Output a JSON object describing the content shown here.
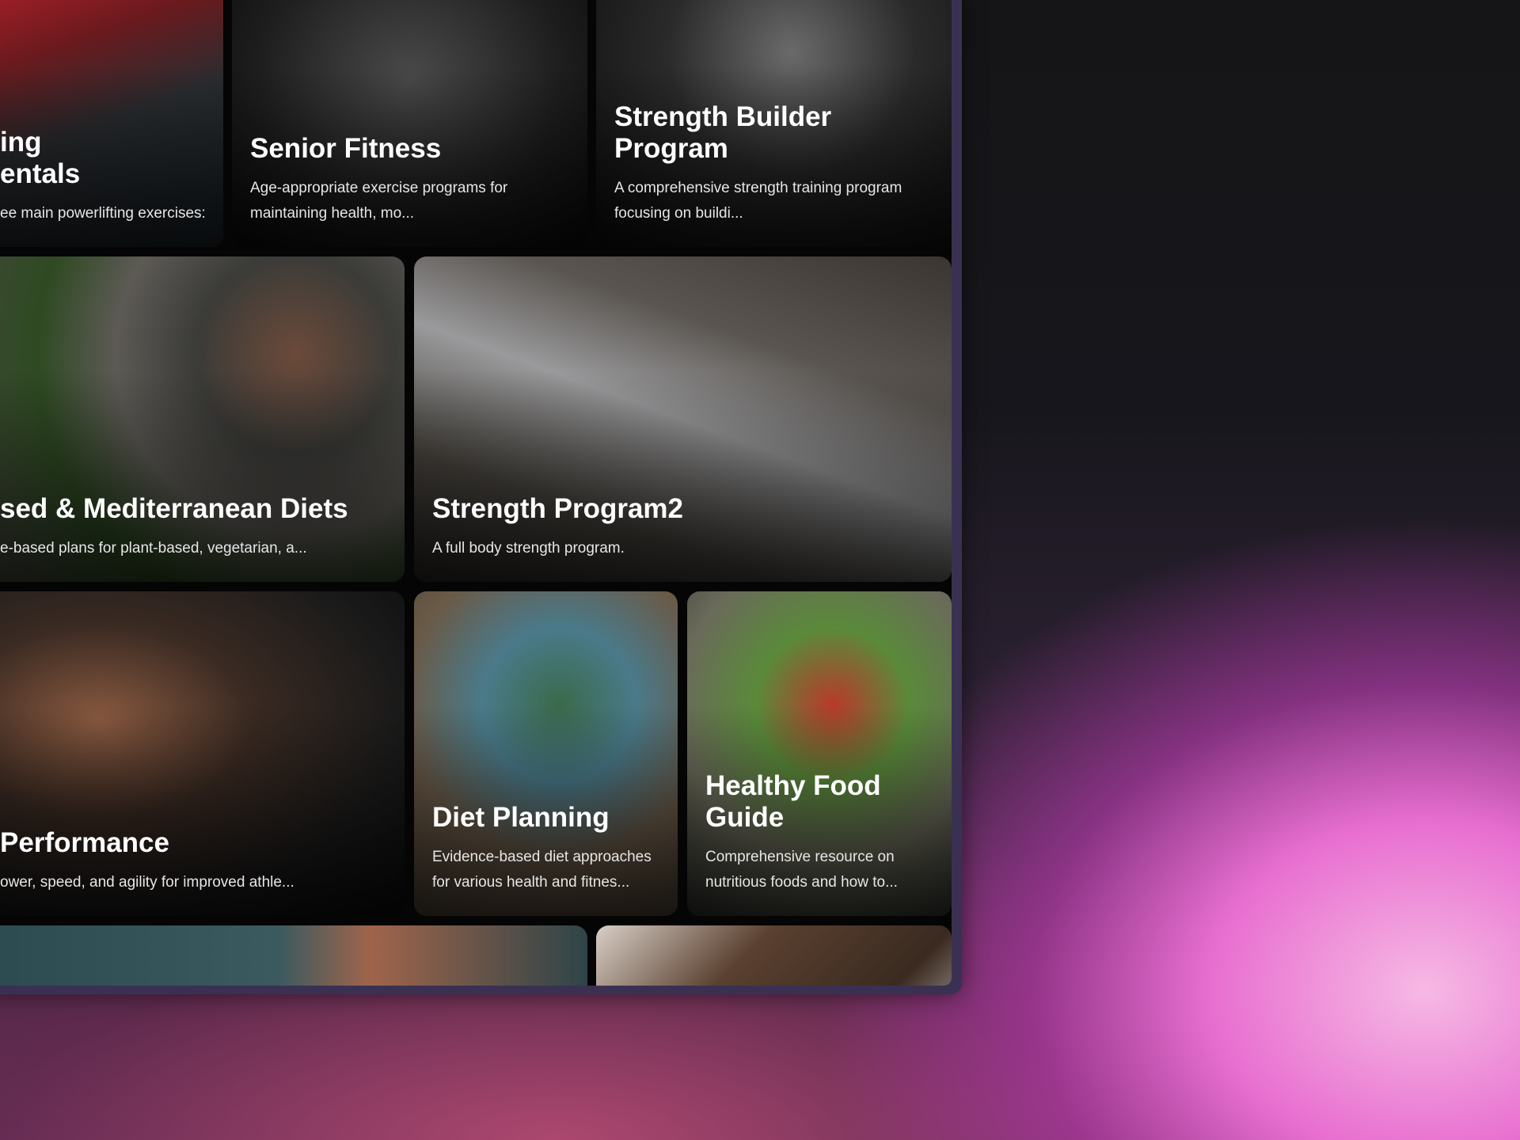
{
  "cards": [
    {
      "title_lines": [
        "ing",
        "entals"
      ],
      "description": "ee main powerlifting exercises:"
    },
    {
      "title": "Senior Fitness",
      "description": "Age-appropriate exercise programs for maintaining health, mo..."
    },
    {
      "title": "Strength Builder Program",
      "description": "A comprehensive strength training program focusing on buildi..."
    },
    {
      "title": "sed & Mediterranean Diets",
      "description": "e-based plans for plant-based, vegetarian, a..."
    },
    {
      "title": "Strength Program2",
      "description": "A full body strength program."
    },
    {
      "title": "Performance",
      "description": "ower, speed, and agility for improved athle..."
    },
    {
      "title": "Diet Planning",
      "description": "Evidence-based diet approaches for various health and fitnes..."
    },
    {
      "title": "Healthy Food Guide",
      "description": "Comprehensive resource on nutritious foods and how to..."
    }
  ],
  "colors": {
    "frame": "#3a3152",
    "background_accent": "#e86fd0"
  }
}
